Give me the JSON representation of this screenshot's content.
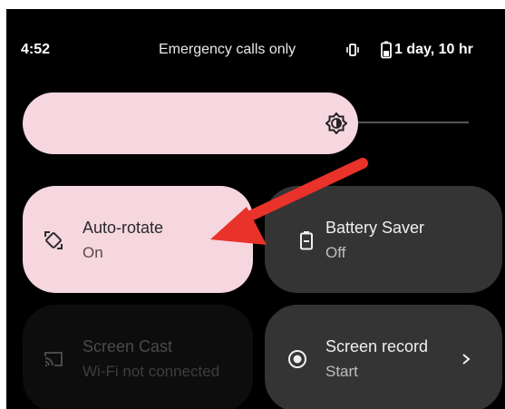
{
  "status_bar": {
    "time": "4:52",
    "network_status": "Emergency calls only",
    "battery_text": "1 day, 10 hr"
  },
  "brightness": {
    "icon": "brightness-icon",
    "level": 0.7
  },
  "tiles": [
    {
      "id": "auto-rotate",
      "label": "Auto-rotate",
      "state": "On",
      "icon": "rotate-icon",
      "active": true
    },
    {
      "id": "battery-saver",
      "label": "Battery Saver",
      "state": "Off",
      "icon": "battery-icon",
      "active": false
    },
    {
      "id": "screen-cast",
      "label": "Screen Cast",
      "state": "Wi-Fi not connected",
      "icon": "cast-icon",
      "active": false,
      "disabled": true
    },
    {
      "id": "screen-record",
      "label": "Screen record",
      "state": "Start",
      "icon": "record-icon",
      "active": false,
      "has_chevron": true
    }
  ],
  "colors": {
    "background": "#000000",
    "active_tile": "#f6d6df",
    "inactive_tile": "#343434",
    "annotation_arrow": "#e8322a"
  }
}
